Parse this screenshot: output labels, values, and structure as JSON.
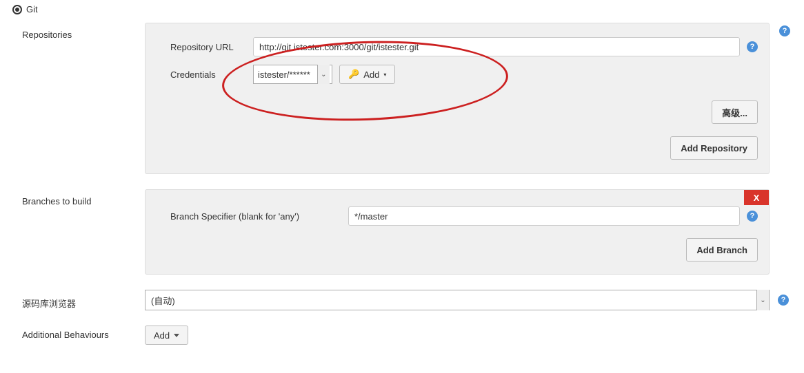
{
  "git": {
    "radio_label": "Git"
  },
  "repositories": {
    "section_label": "Repositories",
    "repo_url_label": "Repository URL",
    "repo_url_value": "http://git.istester.com:3000/git/istester.git",
    "credentials_label": "Credentials",
    "credentials_selected": "istester/******",
    "add_cred_button": "Add",
    "advanced_button": "高级...",
    "add_repo_button": "Add Repository"
  },
  "branches": {
    "section_label": "Branches to build",
    "specifier_label": "Branch Specifier (blank for 'any')",
    "specifier_value": "*/master",
    "add_branch_button": "Add Branch",
    "close_label": "X"
  },
  "browser": {
    "section_label": "源码库浏览器",
    "selected": "(自动)"
  },
  "behaviours": {
    "section_label": "Additional Behaviours",
    "add_button": "Add"
  },
  "help": "?"
}
